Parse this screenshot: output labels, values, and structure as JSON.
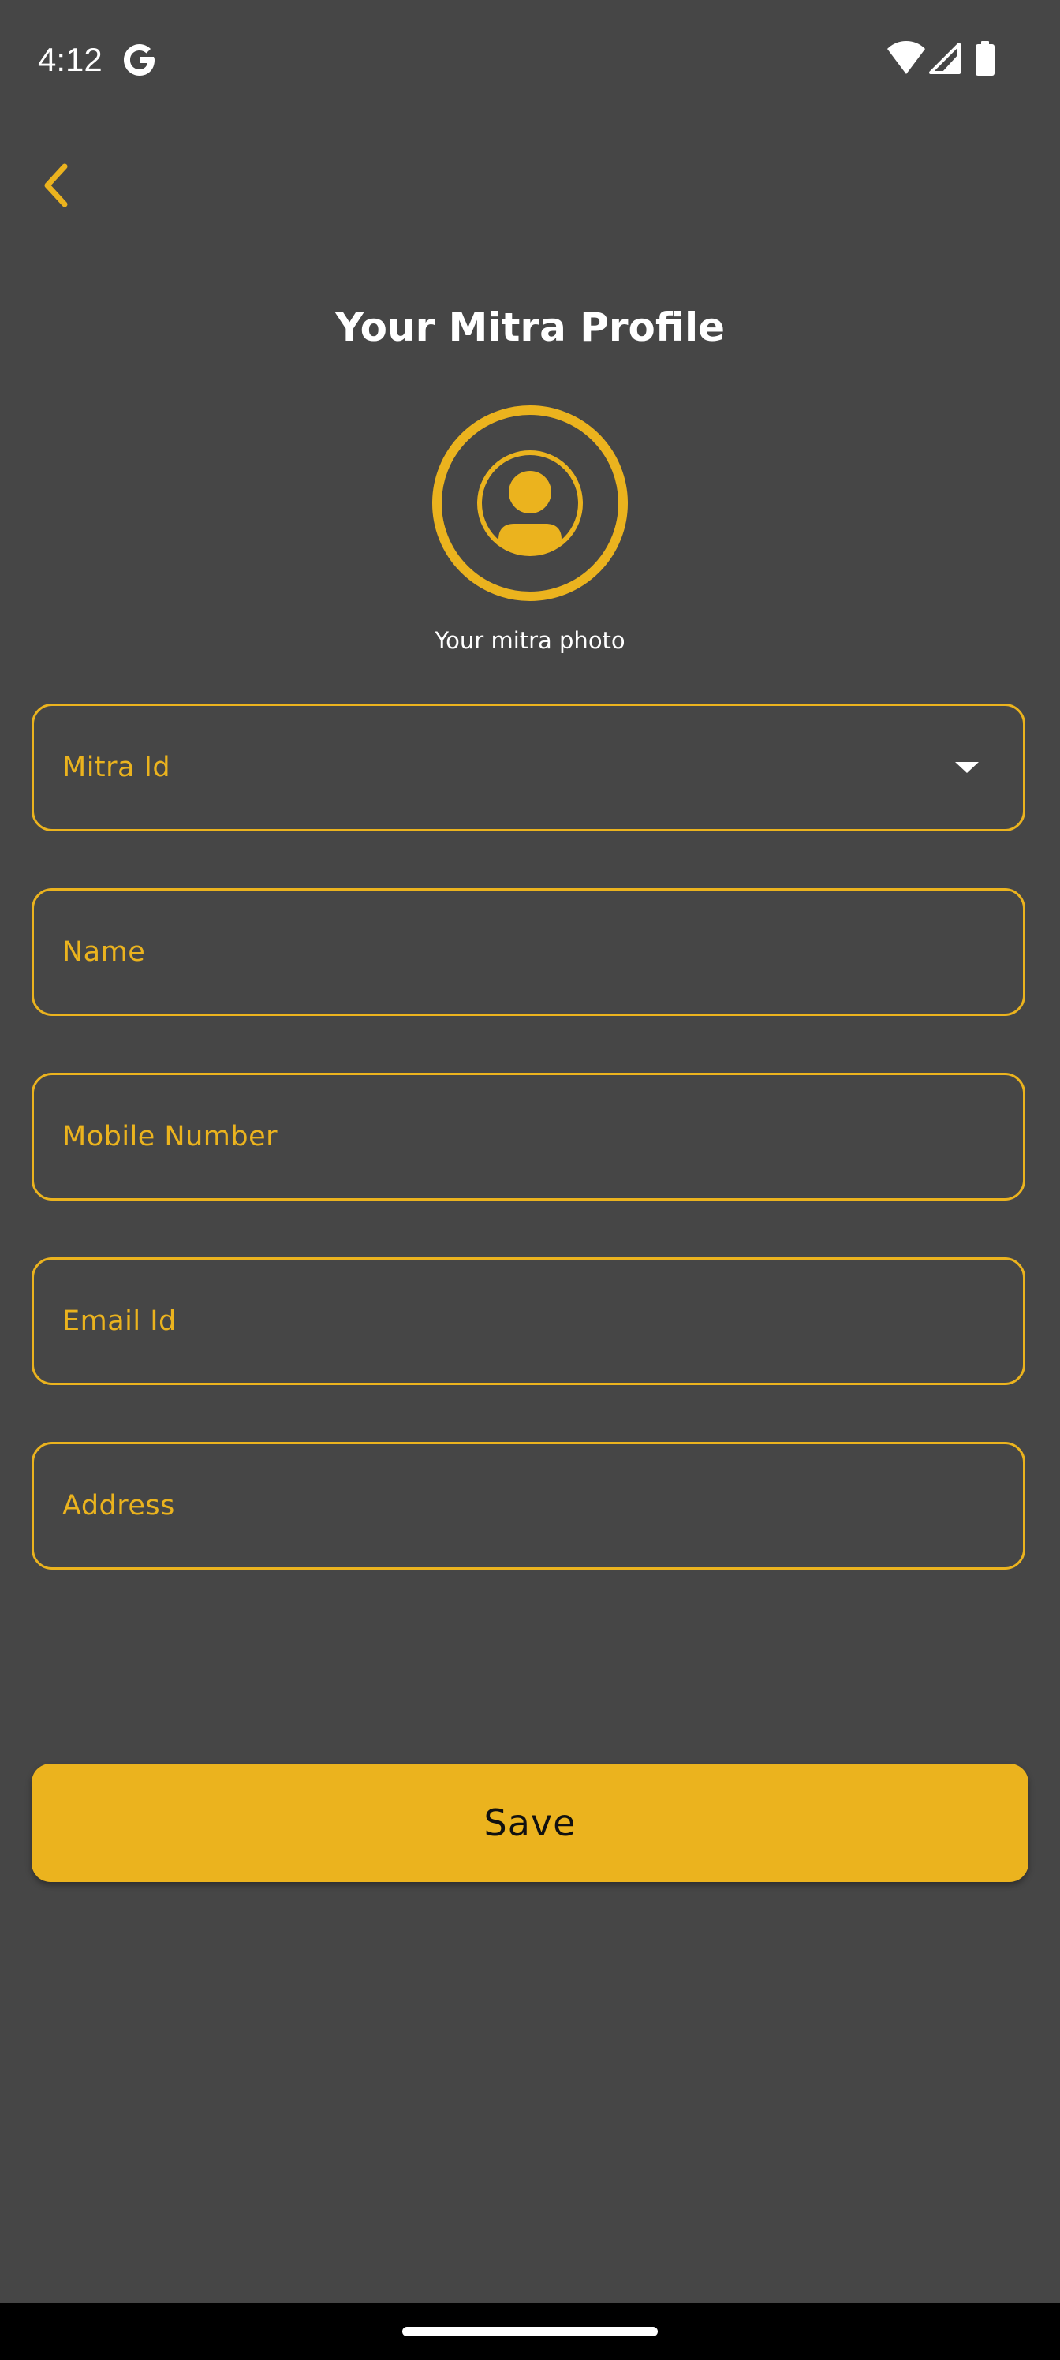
{
  "status_bar": {
    "time": "4:12",
    "icons": [
      "google-icon",
      "wifi-icon",
      "signal-icon",
      "battery-icon"
    ]
  },
  "header": {
    "back_icon": "chevron-left-icon",
    "title": "Your Mitra Profile"
  },
  "profile": {
    "avatar_icon": "user-avatar-icon",
    "caption": "Your mitra photo"
  },
  "form": {
    "mitra_id_label": "Mitra Id",
    "name_label": "Name",
    "mobile_label": "Mobile Number",
    "email_label": "Email Id",
    "address_label": "Address"
  },
  "actions": {
    "save_label": "Save"
  },
  "colors": {
    "background": "#464646",
    "accent": "#ebb31e",
    "text": "#ffffff"
  }
}
